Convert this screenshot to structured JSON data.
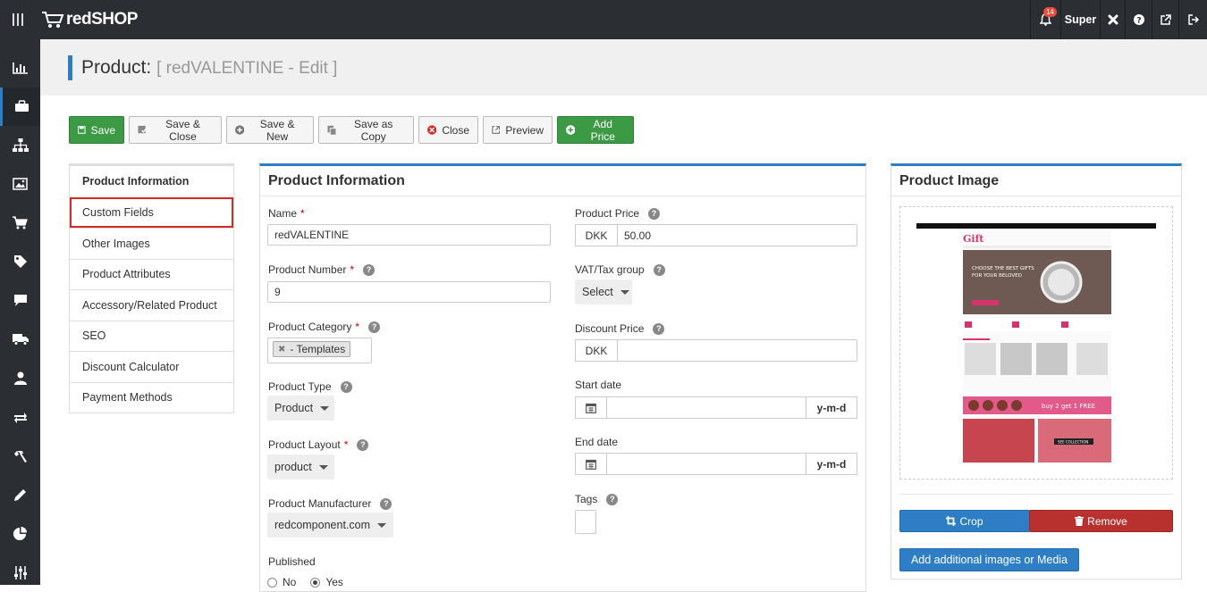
{
  "app": {
    "logo_text": "redSHOP",
    "notification_count": "14",
    "user_name": "Super"
  },
  "header": {
    "title": "Product:",
    "subtitle": "[ redVALENTINE - Edit ]"
  },
  "toolbar": {
    "save": "Save",
    "save_close": "Save & Close",
    "save_new": "Save & New",
    "save_copy": "Save as Copy",
    "close": "Close",
    "preview": "Preview",
    "add_price": "Add Price"
  },
  "tabs": [
    "Product Information",
    "Custom Fields",
    "Other Images",
    "Product Attributes",
    "Accessory/Related Product",
    "SEO",
    "Discount Calculator",
    "Payment Methods"
  ],
  "form": {
    "panel_title": "Product Information",
    "name_label": "Name",
    "name_value": "redVALENTINE",
    "number_label": "Product Number",
    "number_value": "9",
    "category_label": "Product Category",
    "category_value": "- Templates",
    "type_label": "Product Type",
    "type_value": "Product",
    "layout_label": "Product Layout",
    "layout_value": "product",
    "manufacturer_label": "Product Manufacturer",
    "manufacturer_value": "redcomponent.com",
    "published_label": "Published",
    "published_no": "No",
    "published_yes": "Yes",
    "price_label": "Product Price",
    "price_currency": "DKK",
    "price_value": "50.00",
    "vat_label": "VAT/Tax group",
    "vat_value": "Select",
    "discount_label": "Discount Price",
    "discount_currency": "DKK",
    "start_label": "Start date",
    "start_format": "y-m-d",
    "end_label": "End date",
    "end_format": "y-m-d",
    "tags_label": "Tags",
    "required_mark": "*"
  },
  "image_panel": {
    "title": "Product Image",
    "crop": "Crop",
    "remove": "Remove",
    "add_more": "Add additional images or Media",
    "preview": {
      "brand": "Gift",
      "hero_text_1": "CHOOSE THE BEST GIFTS",
      "hero_text_2": "FOR YOUR BELOVED",
      "offer": "buy 2 get 1 FREE",
      "collection": "SEE COLLECTION"
    }
  },
  "colors": {
    "primary": "#2e7ec6",
    "success": "#3c9a45",
    "danger": "#b8312f",
    "dark": "#2b2f33"
  }
}
